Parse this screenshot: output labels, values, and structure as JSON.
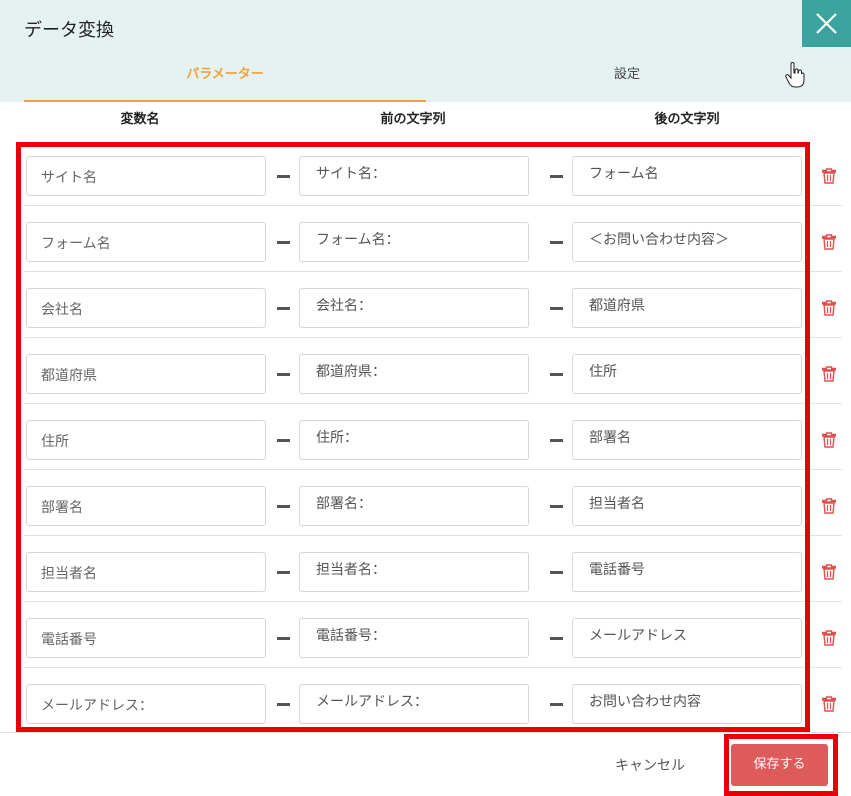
{
  "dialog": {
    "title": "データ変換"
  },
  "tabs": [
    {
      "label": "パラメーター",
      "active": true
    },
    {
      "label": "設定",
      "active": false
    }
  ],
  "columns": {
    "name": "変数名",
    "before": "前の文字列",
    "after": "後の文字列"
  },
  "rows": [
    {
      "name": "サイト名",
      "before": "サイト名：",
      "after": "フォーム名"
    },
    {
      "name": "フォーム名",
      "before": "フォーム名：",
      "after": "＜お問い合わせ内容＞"
    },
    {
      "name": "会社名",
      "before": "会社名：",
      "after": "都道府県"
    },
    {
      "name": "都道府県",
      "before": "都道府県：",
      "after": "住所"
    },
    {
      "name": "住所",
      "before": "住所：",
      "after": "部署名"
    },
    {
      "name": "部署名",
      "before": "部署名：",
      "after": "担当者名"
    },
    {
      "name": "担当者名",
      "before": "担当者名：",
      "after": "電話番号"
    },
    {
      "name": "電話番号",
      "before": "電話番号：",
      "after": "メールアドレス"
    },
    {
      "name": "メールアドレス：",
      "before": "メールアドレス：",
      "after": "お問い合わせ内容"
    }
  ],
  "footer": {
    "cancel_label": "キャンセル",
    "save_label": "保存する"
  },
  "colors": {
    "accent": "#f0a23a",
    "close_bg": "#3aa39d",
    "save_bg": "#dd5b5b",
    "highlight": "#e8000b",
    "delete_icon": "#e05050"
  }
}
